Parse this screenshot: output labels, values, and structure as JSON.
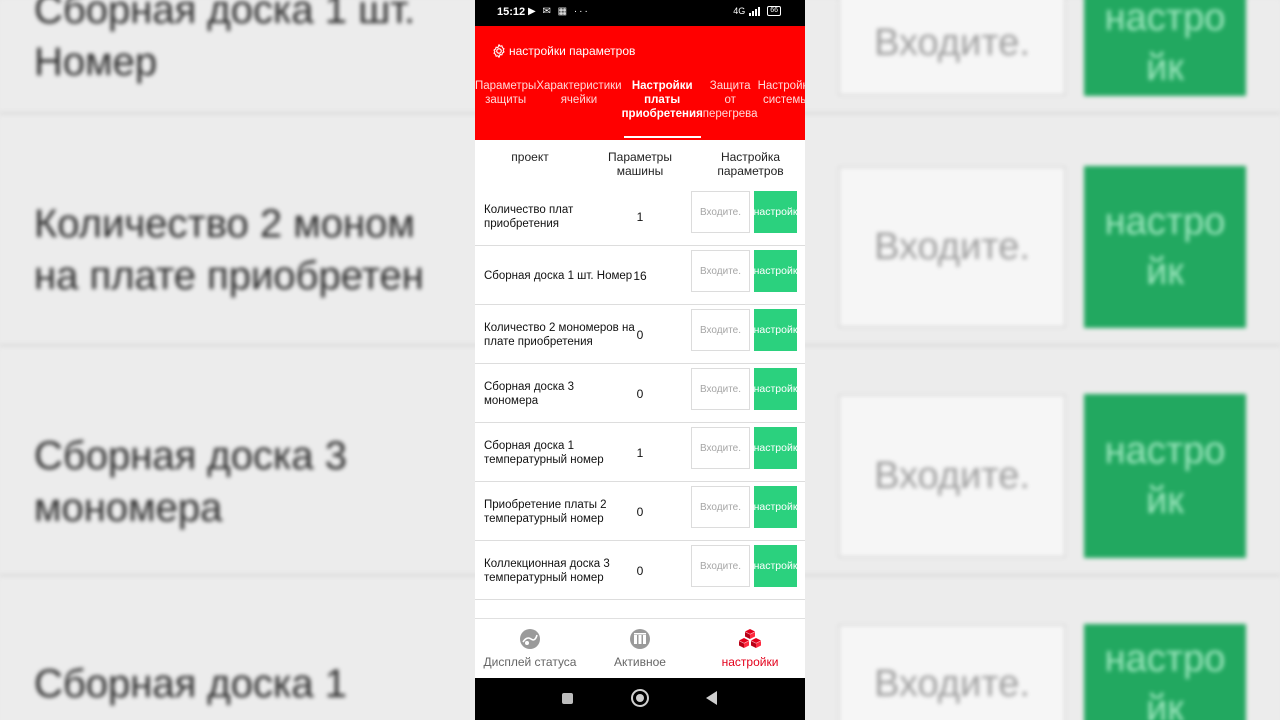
{
  "status_bar": {
    "time": "15:12",
    "icons_left": "▶ ✉ ▦ ···",
    "network": "4G",
    "battery": "66"
  },
  "header": {
    "title": "настройки параметров"
  },
  "tabs": [
    {
      "label": "Параметры защиты"
    },
    {
      "label": "Характеристики ячейки"
    },
    {
      "label": "Настройки платы приобретения"
    },
    {
      "label": "Защита от перегрева"
    },
    {
      "label": "Настройки системы"
    }
  ],
  "table": {
    "headers": {
      "project": "проект",
      "machine_params": "Параметры машины",
      "param_setting": "Настройка параметров"
    },
    "input_placeholder": "Входите.",
    "button_label": "настройк",
    "rows": [
      {
        "name": "Количество плат приобретения",
        "value": "1"
      },
      {
        "name": "Сборная доска 1 шт. Номер",
        "value": "16"
      },
      {
        "name": "Количество 2 мономеров на плате приобретения",
        "value": "0"
      },
      {
        "name": "Сборная доска 3 мономера",
        "value": "0"
      },
      {
        "name": "Сборная доска 1 температурный номер",
        "value": "1"
      },
      {
        "name": "Приобретение платы 2 температурный номер",
        "value": "0"
      },
      {
        "name": "Коллекционная доска 3 температурный номер",
        "value": "0"
      }
    ]
  },
  "bottom_nav": [
    {
      "label": "Дисплей статуса",
      "icon": "status-display-icon"
    },
    {
      "label": "Активное",
      "icon": "active-icon"
    },
    {
      "label": "настройки",
      "icon": "settings-cubes-icon"
    }
  ],
  "background": {
    "texts": [
      "Сборная доска 1 шт.\nНомер",
      "Количество 2 моном\nна плате приобретен",
      "Сборная доска 3\nмономера",
      "Сборная доска 1"
    ],
    "input_placeholder": "Входите.",
    "button_label": "настро\nйк"
  },
  "colors": {
    "header_red": "#ff0000",
    "button_green": "#2bd17e",
    "active_nav_red": "#e3001b"
  }
}
